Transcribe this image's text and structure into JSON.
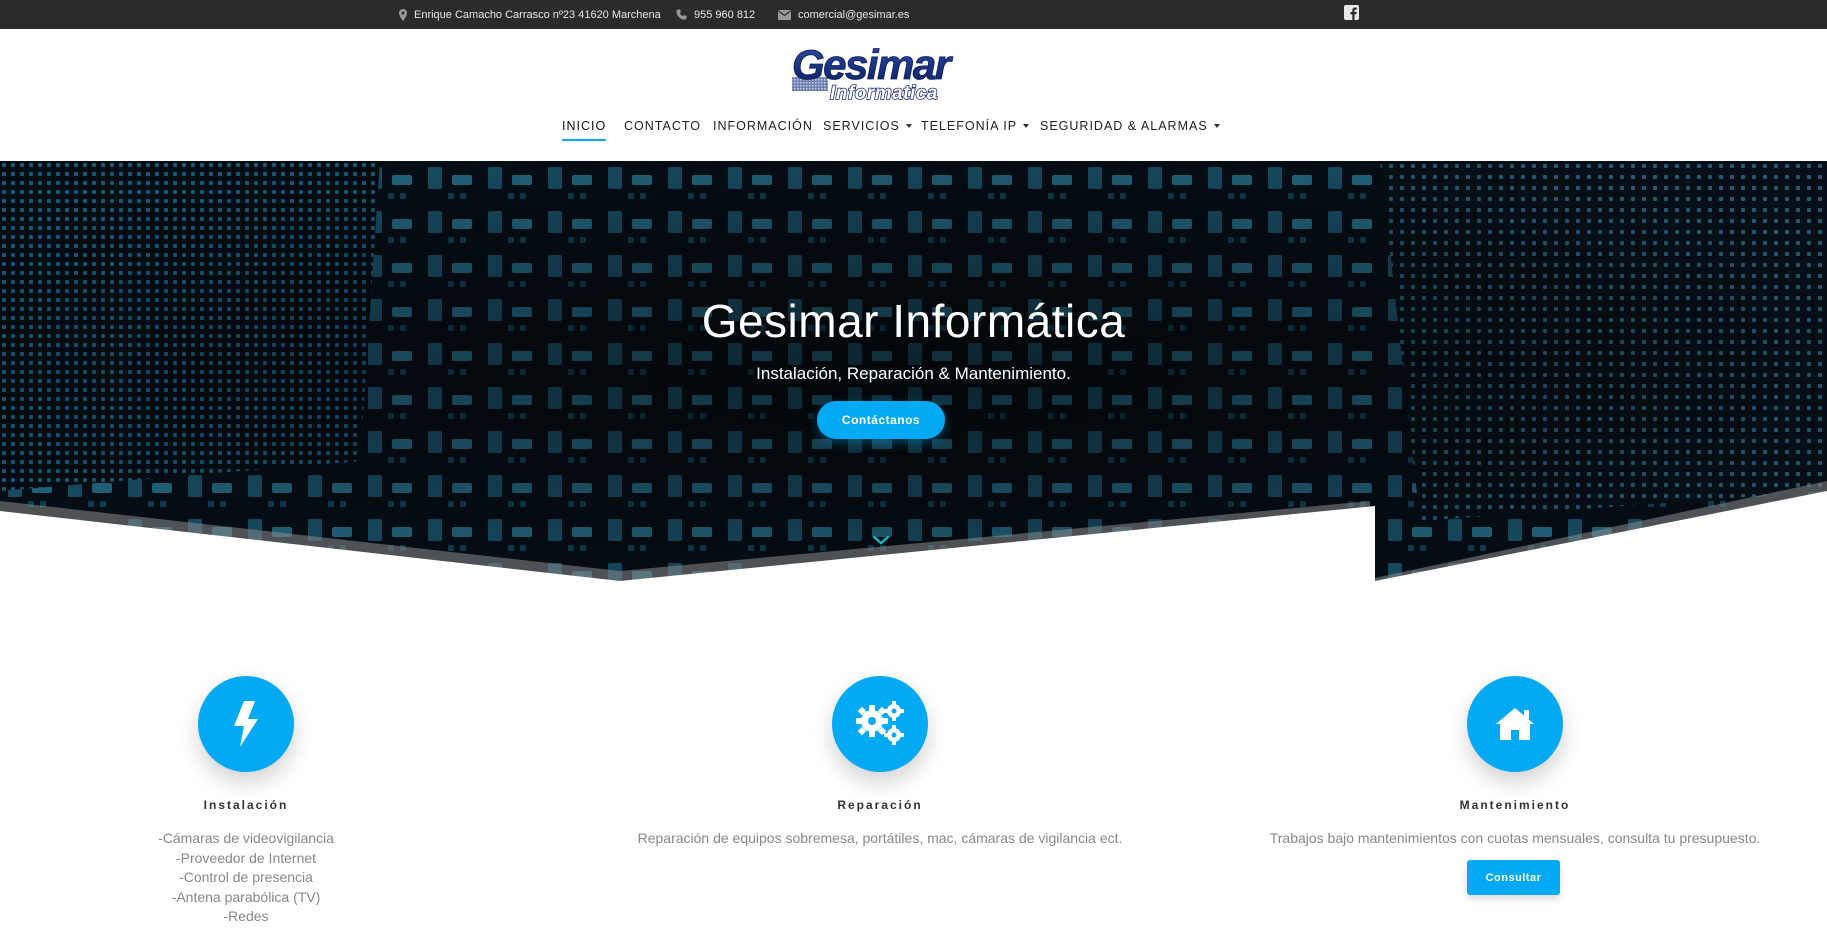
{
  "topbar": {
    "address": "Enrique Camacho Carrasco nº23 41620 Marchena",
    "phone": "955 960 812",
    "email": "comercial@gesimar.es",
    "social_icon": "facebook-icon"
  },
  "logo": {
    "primary": "Gesimar",
    "secondary": "Informatica"
  },
  "nav": {
    "items": [
      {
        "label": "INICIO",
        "active": true,
        "dropdown": false
      },
      {
        "label": "CONTACTO",
        "active": false,
        "dropdown": false
      },
      {
        "label": "INFORMACIÓN",
        "active": false,
        "dropdown": false
      },
      {
        "label": "SERVICIOS",
        "active": false,
        "dropdown": true
      },
      {
        "label": "TELEFONÍA IP",
        "active": false,
        "dropdown": true
      },
      {
        "label": "SEGURIDAD & ALARMAS",
        "active": false,
        "dropdown": true
      }
    ]
  },
  "hero": {
    "title": "Gesimar Informática",
    "subtitle": "Instalación, Reparación & Mantenimiento.",
    "cta": "Contáctanos"
  },
  "features": [
    {
      "icon": "bolt-icon",
      "title": "Instalación",
      "lines": [
        "-Cámaras de videovigilancia",
        "-Proveedor de Internet",
        "-Control de presencia",
        "-Antena parabólica (TV)",
        "-Redes"
      ]
    },
    {
      "icon": "gears-icon",
      "title": "Reparación",
      "lines": [
        "Reparación de equipos sobremesa, portátiles, mac, cámaras de vigilancia ect."
      ]
    },
    {
      "icon": "home-icon",
      "title": "Mantenimiento",
      "lines": [
        "Trabajos bajo mantenimientos con cuotas mensuales, consulta tu presupuesto."
      ],
      "button": "Consultar"
    }
  ],
  "colors": {
    "accent": "#03a9f4",
    "topbar": "#2b2b2b"
  }
}
